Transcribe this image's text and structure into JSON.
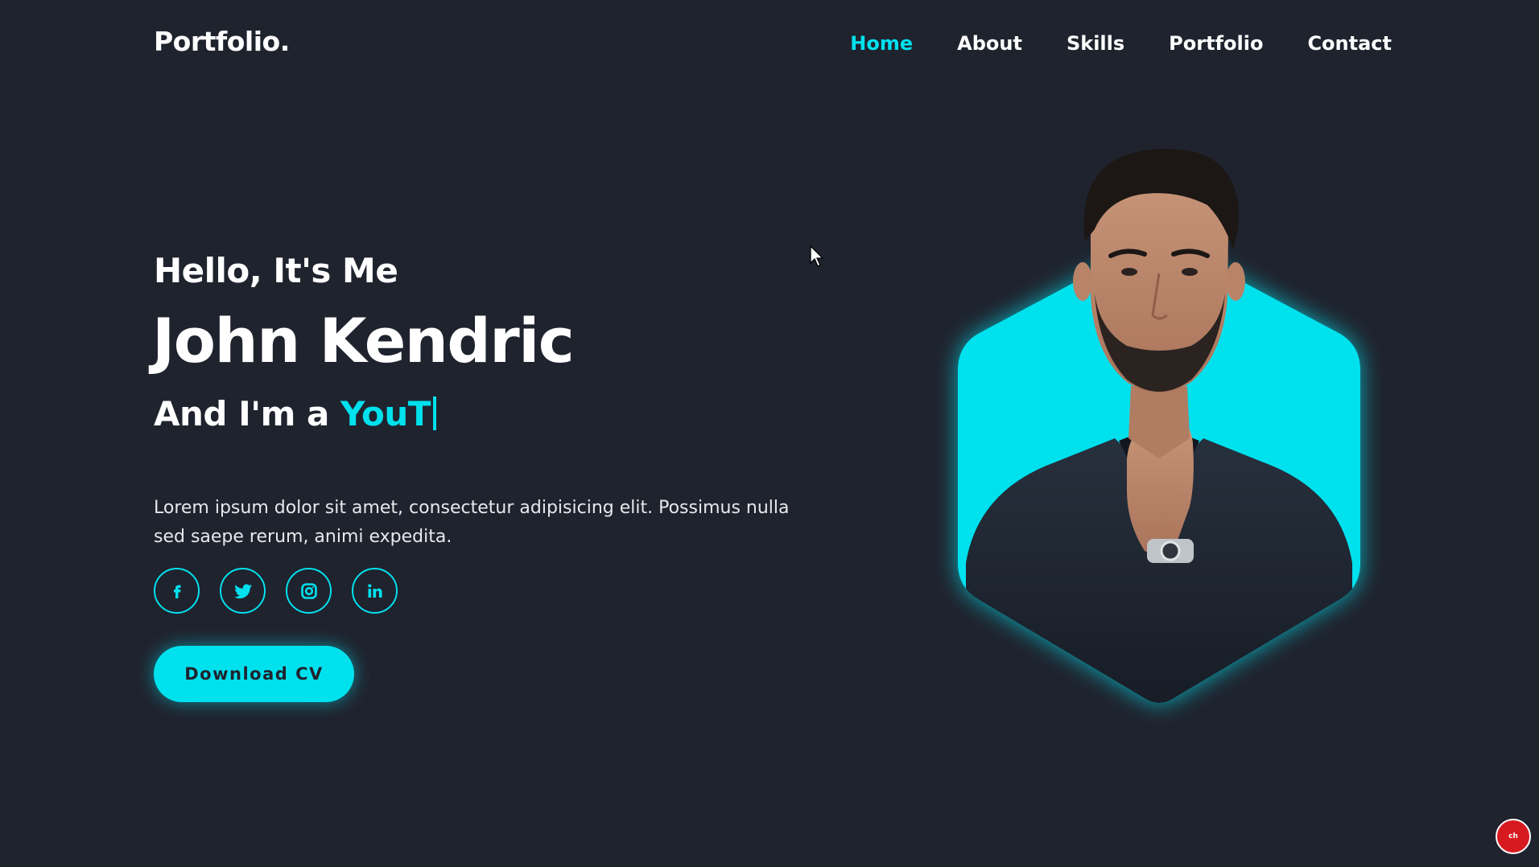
{
  "header": {
    "logo": "Portfolio.",
    "nav": [
      {
        "label": "Home",
        "active": true
      },
      {
        "label": "About",
        "active": false
      },
      {
        "label": "Skills",
        "active": false
      },
      {
        "label": "Portfolio",
        "active": false
      },
      {
        "label": "Contact",
        "active": false
      }
    ]
  },
  "hero": {
    "greeting": "Hello, It's Me",
    "name": "John Kendric",
    "role_prefix": "And I'm a ",
    "role_typed": "YouT",
    "description": "Lorem ipsum dolor sit amet, consectetur adipisicing elit. Possimus nulla sed saepe rerum, animi expedita.",
    "socials": [
      {
        "icon": "facebook-icon"
      },
      {
        "icon": "twitter-icon"
      },
      {
        "icon": "instagram-icon"
      },
      {
        "icon": "linkedin-icon"
      }
    ],
    "cta_label": "Download CV"
  },
  "badge": {
    "text": "ch"
  },
  "colors": {
    "background": "#1f232e",
    "accent": "#00e1ee",
    "text": "#ffffff"
  }
}
